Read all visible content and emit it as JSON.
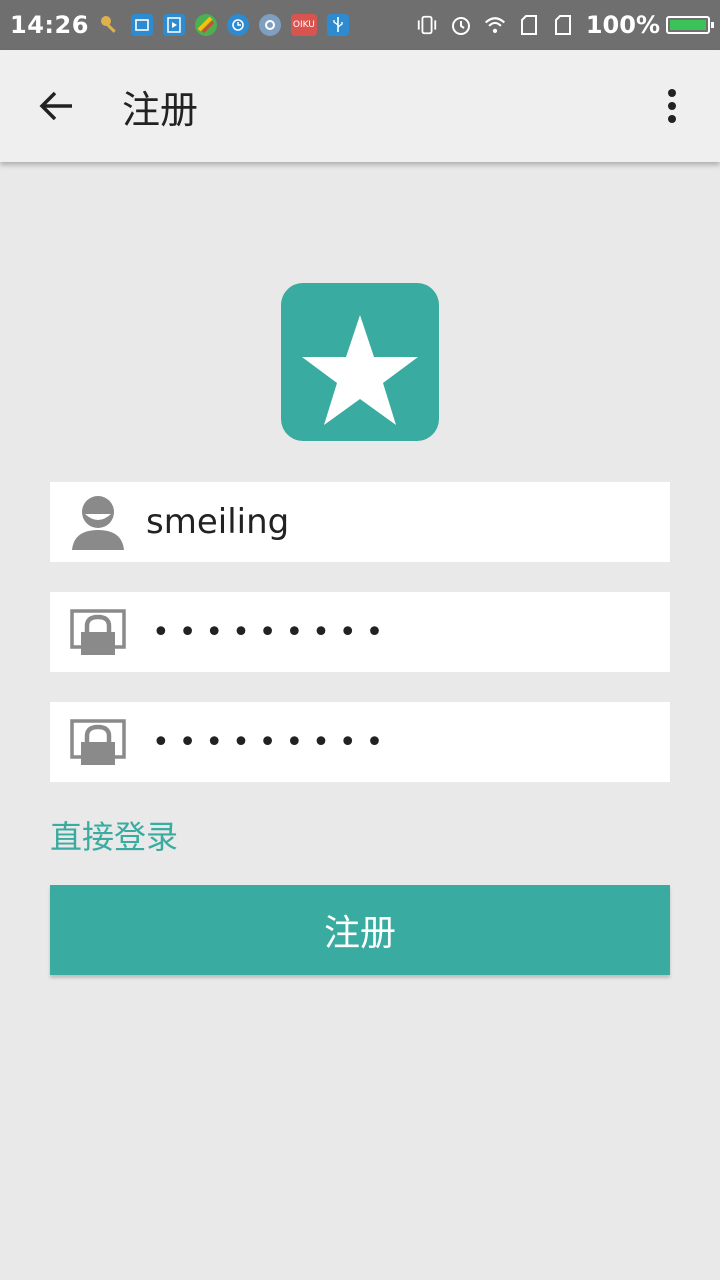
{
  "status_bar": {
    "time": "14:26",
    "left_icons": [
      "key-icon",
      "screenshot-icon",
      "media-icon",
      "maps-icon",
      "sync-icon",
      "settings-icon",
      "oiku-icon",
      "usb-icon"
    ],
    "oiku_label": "OIKU",
    "right_icons": [
      "vibrate-icon",
      "alarm-icon",
      "wifi-icon",
      "sim1-icon",
      "sim2-icon"
    ],
    "battery_text": "100%",
    "battery_color": "#3bc35a"
  },
  "app_bar": {
    "title": "注册"
  },
  "form": {
    "username_value": "smeiling",
    "password_value": "•••••••••",
    "confirm_password_value": "•••••••••",
    "login_link": "直接登录",
    "register_button": "注册"
  },
  "colors": {
    "accent": "#3aaba0",
    "background": "#e9e9e9",
    "appbar": "#efefef",
    "statusbar": "#6f6f6f"
  }
}
